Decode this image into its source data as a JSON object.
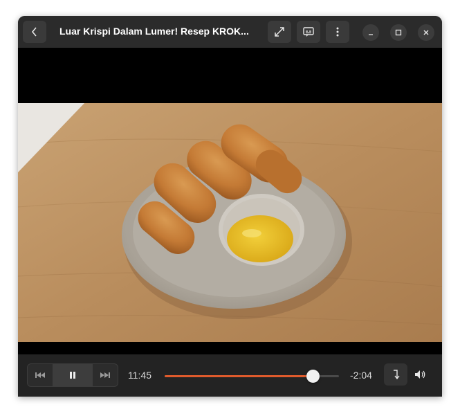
{
  "header": {
    "title": "Luar Krispi Dalam Lumer! Resep KROK...",
    "back_icon": "chevron-left-icon",
    "fullscreen_icon": "fullscreen-icon",
    "subtitles_icon": "subtitles-icon",
    "menu_icon": "kebab-menu-icon"
  },
  "window_controls": {
    "minimize_icon": "minimize-icon",
    "maximize_icon": "maximize-icon",
    "close_icon": "close-icon"
  },
  "video": {
    "content": "croquettes-on-plate-with-sauce"
  },
  "player": {
    "elapsed": "11:45",
    "remaining": "-2:04",
    "progress_fraction": 0.85,
    "skip_back_icon": "skip-back-icon",
    "pause_icon": "pause-icon",
    "skip_forward_icon": "skip-forward-icon",
    "rotate_icon": "rotate-icon",
    "volume_icon": "volume-icon"
  },
  "colors": {
    "accent": "#e05b2c",
    "headerbar": "#2b2b2b",
    "controls": "#232323"
  }
}
